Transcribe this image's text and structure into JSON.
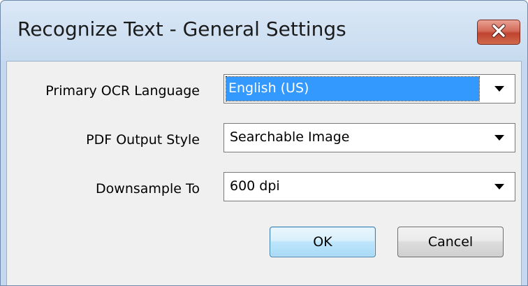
{
  "window": {
    "title": "Recognize Text - General Settings",
    "close_icon": "close-x-icon"
  },
  "form": {
    "primary_ocr_language": {
      "label": "Primary OCR Language",
      "value": "English (US)"
    },
    "pdf_output_style": {
      "label": "PDF Output Style",
      "value": "Searchable Image"
    },
    "downsample_to": {
      "label": "Downsample To",
      "value": "600 dpi"
    }
  },
  "buttons": {
    "ok_label": "OK",
    "cancel_label": "Cancel"
  },
  "colors": {
    "selection": "#3399ff",
    "close_button": "#c9503d",
    "titlebar": "#c7dbf0"
  }
}
